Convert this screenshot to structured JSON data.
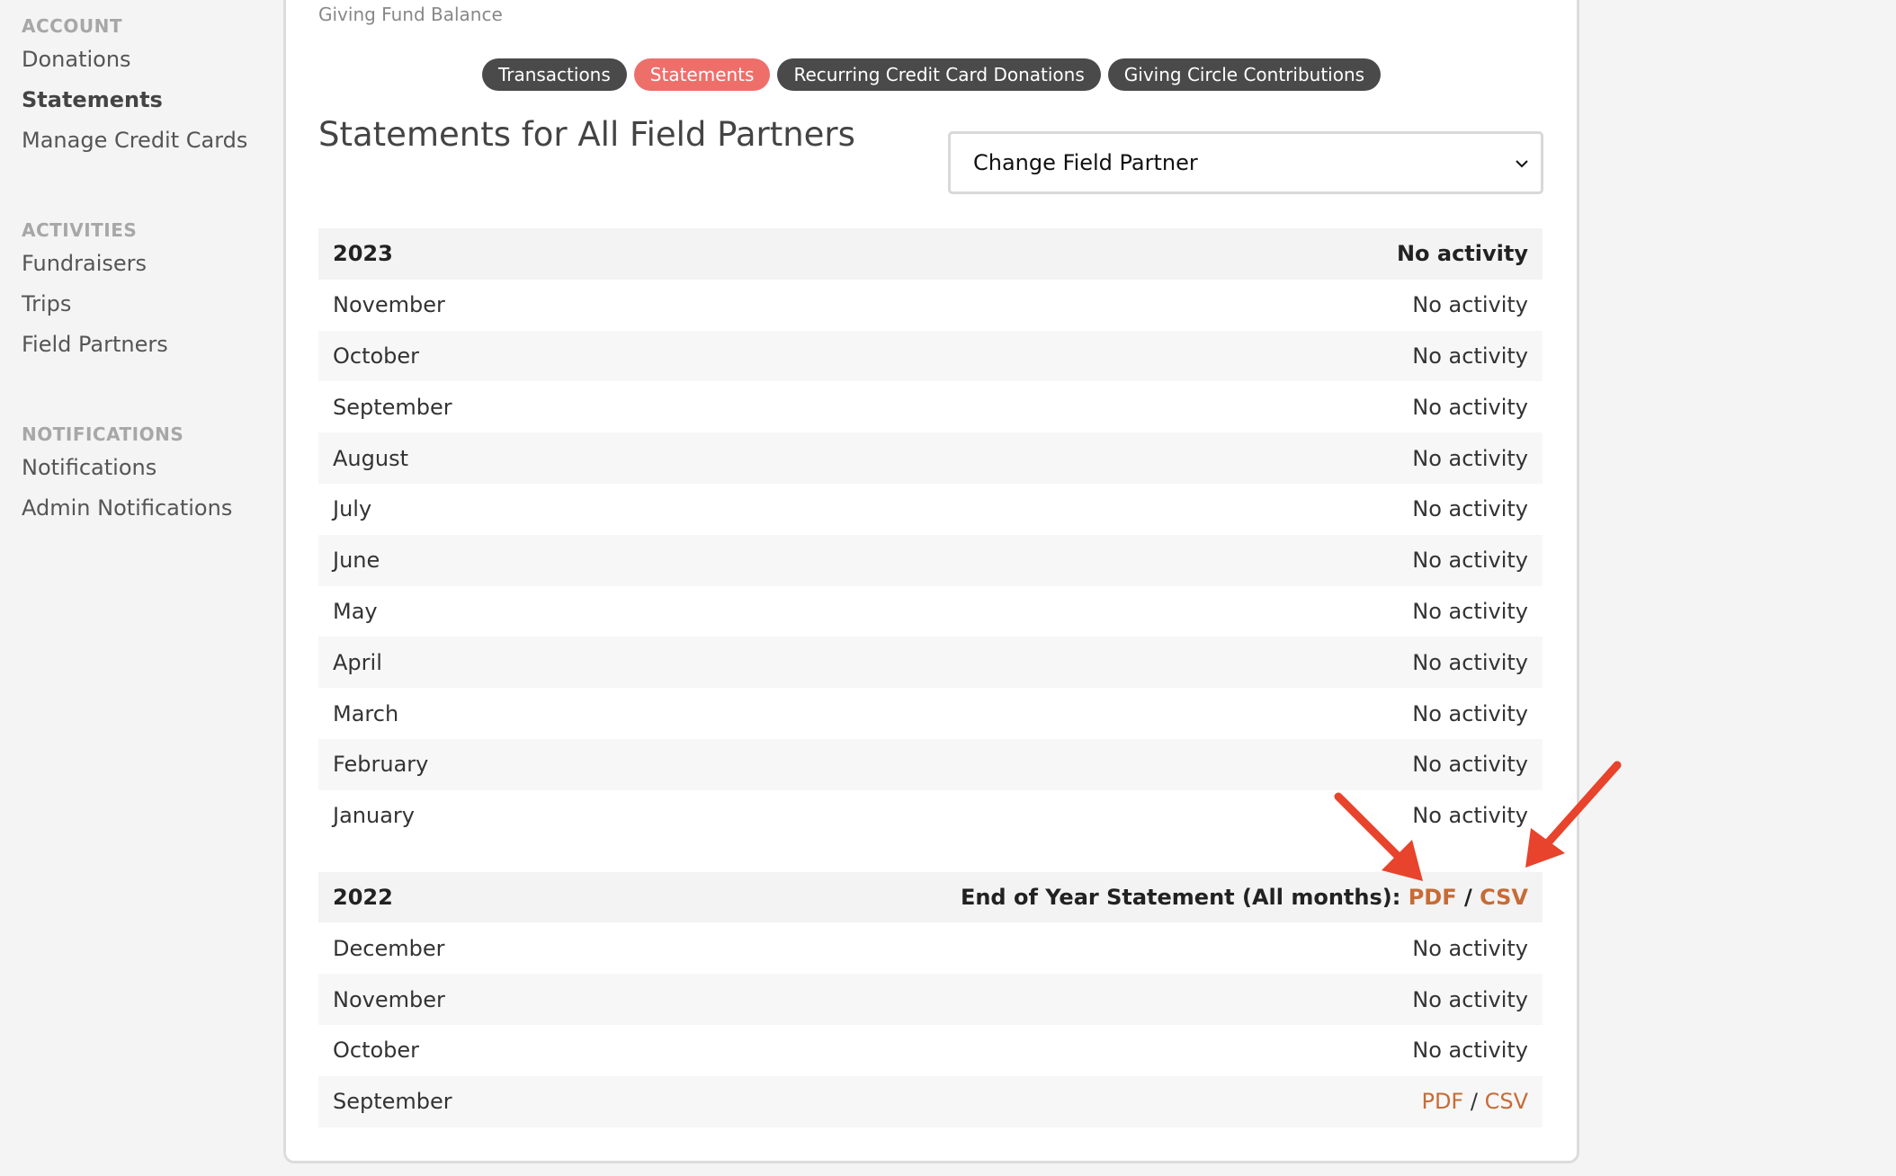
{
  "sidebar": {
    "sections": [
      {
        "heading": "ACCOUNT",
        "items": [
          {
            "label": "Donations",
            "active": false
          },
          {
            "label": "Statements",
            "active": true
          },
          {
            "label": "Manage Credit Cards",
            "active": false
          }
        ]
      },
      {
        "heading": "ACTIVITIES",
        "items": [
          {
            "label": "Fundraisers",
            "active": false
          },
          {
            "label": "Trips",
            "active": false
          },
          {
            "label": "Field Partners",
            "active": false
          }
        ]
      },
      {
        "heading": "NOTIFICATIONS",
        "items": [
          {
            "label": "Notifications",
            "active": false
          },
          {
            "label": "Admin Notifications",
            "active": false
          }
        ]
      }
    ]
  },
  "header": {
    "balance_label": "Giving Fund Balance"
  },
  "tabs": [
    {
      "label": "Transactions",
      "active": false
    },
    {
      "label": "Statements",
      "active": true
    },
    {
      "label": "Recurring Credit Card Donations",
      "active": false
    },
    {
      "label": "Giving Circle Contributions",
      "active": false
    }
  ],
  "main": {
    "title": "Statements for All Field Partners",
    "partner_select": {
      "value": "Change Field Partner",
      "icon": "chevron-down-icon"
    }
  },
  "statements": {
    "y2023": {
      "year": "2023",
      "status": "No activity",
      "months": [
        {
          "month": "November",
          "status": "No activity"
        },
        {
          "month": "October",
          "status": "No activity"
        },
        {
          "month": "September",
          "status": "No activity"
        },
        {
          "month": "August",
          "status": "No activity"
        },
        {
          "month": "July",
          "status": "No activity"
        },
        {
          "month": "June",
          "status": "No activity"
        },
        {
          "month": "May",
          "status": "No activity"
        },
        {
          "month": "April",
          "status": "No activity"
        },
        {
          "month": "March",
          "status": "No activity"
        },
        {
          "month": "February",
          "status": "No activity"
        },
        {
          "month": "January",
          "status": "No activity"
        }
      ]
    },
    "y2022": {
      "year": "2022",
      "eoy_label": "End of Year Statement (All months): ",
      "pdf": "PDF",
      "csv": "CSV",
      "separator": " / ",
      "months": [
        {
          "month": "December",
          "status": "No activity"
        },
        {
          "month": "November",
          "status": "No activity"
        },
        {
          "month": "October",
          "status": "No activity"
        },
        {
          "month": "September",
          "pdf": "PDF",
          "csv": "CSV"
        }
      ]
    }
  },
  "annotations": {
    "arrow_color": "#e8432c"
  }
}
